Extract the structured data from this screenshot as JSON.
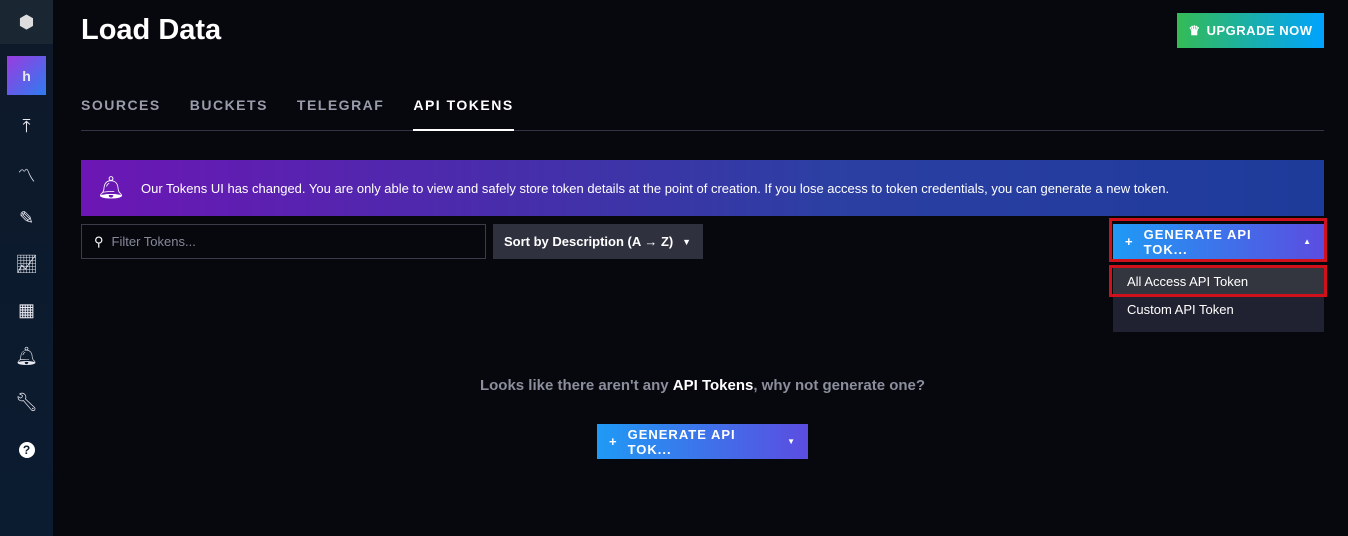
{
  "sidebar": {
    "org_initial": "h",
    "icons": [
      "upload-icon",
      "data-explorer-icon",
      "notebook-icon",
      "dashboard-icon",
      "tasks-calendar-icon",
      "alerts-bell-icon",
      "settings-wrench-icon",
      "help-icon"
    ]
  },
  "header": {
    "title": "Load Data",
    "upgrade_label": "UPGRADE NOW"
  },
  "tabs": [
    {
      "label": "SOURCES"
    },
    {
      "label": "BUCKETS"
    },
    {
      "label": "TELEGRAF"
    },
    {
      "label": "API TOKENS",
      "active": true
    }
  ],
  "banner": {
    "text": "Our Tokens UI has changed. You are only able to view and safely store token details at the point of creation. If you lose access to token credentials, you can generate a new token."
  },
  "filter": {
    "placeholder": "Filter Tokens...",
    "value": ""
  },
  "sort": {
    "label": "Sort by Description (A → Z)"
  },
  "generate": {
    "label": "GENERATE API TOK...",
    "menu": [
      "All Access API Token",
      "Custom API Token"
    ]
  },
  "empty": {
    "prefix": "Looks like there aren't any ",
    "strong": "API Tokens",
    "suffix": ", why not generate one?"
  },
  "colors": {
    "highlight": "#d0101a",
    "accent_start": "#1f9af5",
    "accent_end": "#5b4de0"
  }
}
